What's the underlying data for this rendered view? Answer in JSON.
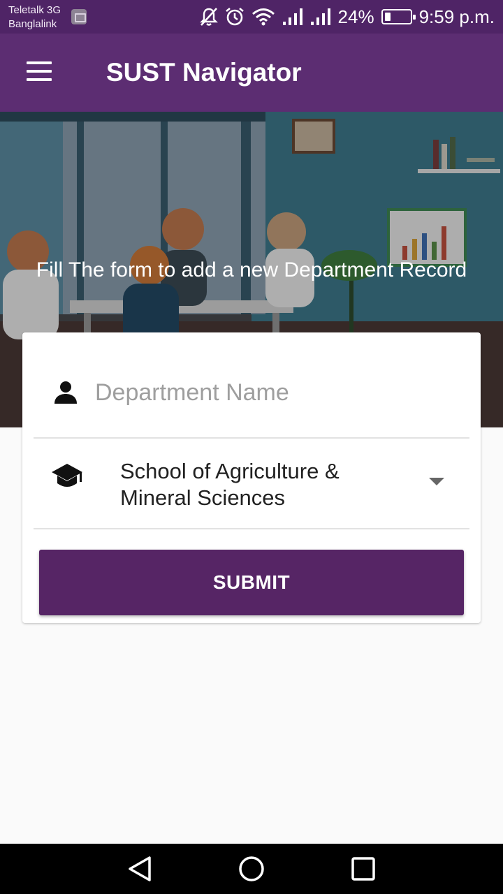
{
  "status_bar": {
    "carrier_line1": "Teletalk 3G",
    "carrier_line2": "Banglalink",
    "battery_percent": "24%",
    "battery_level": 0.24,
    "time": "9:59 p.m.",
    "icons": [
      "image-icon",
      "mute-icon",
      "alarm-icon",
      "wifi-icon",
      "signal-icon",
      "signal-icon",
      "battery-icon"
    ]
  },
  "app_bar": {
    "title": "SUST Navigator",
    "menu_icon": "hamburger-menu-icon"
  },
  "hero": {
    "text": "Fill The form to add a new Department Record"
  },
  "form": {
    "department_name": {
      "value": "",
      "placeholder": "Department Name",
      "icon": "person-icon"
    },
    "school": {
      "selected": "School of Agriculture & Mineral Sciences",
      "icon": "graduation-cap-icon"
    },
    "submit_label": "SUBMIT"
  },
  "nav_bar": {
    "icons": [
      "back-icon",
      "home-icon",
      "recent-apps-icon"
    ]
  },
  "colors": {
    "status_bar": "#4f2466",
    "app_bar": "#5c2d72",
    "button": "#562565",
    "background": "#fafafa"
  }
}
